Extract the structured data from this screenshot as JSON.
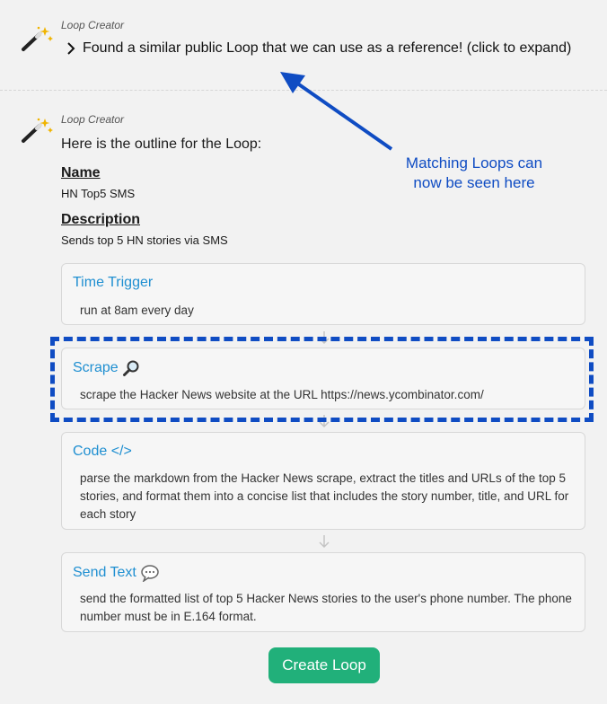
{
  "messages": [
    {
      "author": "Loop Creator",
      "text": "Found a similar public Loop that we can use as a reference! (click to expand)"
    },
    {
      "author": "Loop Creator",
      "intro": "Here is the outline for the Loop:"
    }
  ],
  "outline": {
    "name_label": "Name",
    "name_value": "HN Top5 SMS",
    "description_label": "Description",
    "description_value": "Sends top 5 HN stories via SMS",
    "steps": [
      {
        "title": "Time Trigger",
        "icon": "",
        "description": "run at 8am every day"
      },
      {
        "title": "Scrape",
        "icon": "magnifier-icon",
        "description": "scrape the Hacker News website at the URL https://news.ycombinator.com/"
      },
      {
        "title": "Code </>",
        "icon": "",
        "description": "parse the markdown from the Hacker News scrape, extract the titles and URLs of the top 5 stories, and format them into a concise list that includes the story number, title, and URL for each story"
      },
      {
        "title": "Send Text",
        "icon": "speech-bubble-icon",
        "description": "send the formatted list of top 5 Hacker News stories to the user's phone number. The phone number must be in E.164 format."
      }
    ]
  },
  "annotation": {
    "text": "Matching Loops can now be seen here",
    "color": "#0f4cc3"
  },
  "create_button": {
    "label": "Create Loop",
    "color": "#21b07a"
  },
  "colors": {
    "step_title": "#1f8fd1",
    "background": "#f2f2f2"
  }
}
